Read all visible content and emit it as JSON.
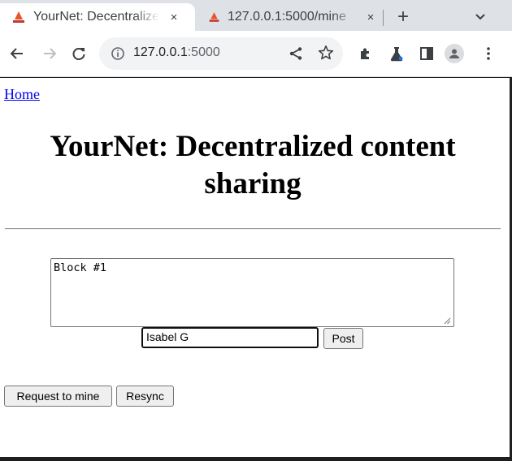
{
  "browser": {
    "tabs": [
      {
        "title": "YourNet: Decentralized content sharing",
        "active": true
      },
      {
        "title": "127.0.0.1:5000/mine",
        "active": false
      }
    ],
    "new_tab": "+",
    "address": {
      "host": "127.0.0.1",
      "port": ":5000"
    },
    "close_glyph": "×"
  },
  "page": {
    "home_link": "Home",
    "heading": "YourNet: Decentralized content sharing",
    "content_textarea": "Block #1",
    "author_input": "Isabel G",
    "post_button": "Post",
    "request_mine_button": "Request to mine",
    "resync_button": "Resync"
  },
  "colors": {
    "tab_strip": "#dee1e6",
    "link": "#0000ee",
    "favicon": "#e8542c",
    "button_face": "#efefef"
  }
}
